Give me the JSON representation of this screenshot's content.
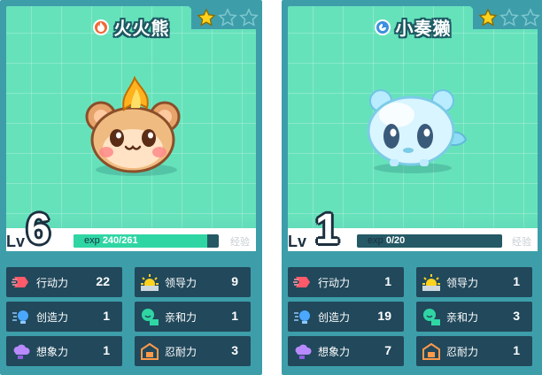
{
  "cards": [
    {
      "name": "火火熊",
      "element": "fire",
      "stars_filled": 1,
      "stars_total": 3,
      "level_label": "Lv",
      "level": "6",
      "exp_label": "exp",
      "exp_current": "240",
      "exp_max": "/261",
      "exp_fraction": 0.92,
      "upgrade_label": "经验",
      "stats": [
        {
          "label": "行动力",
          "value": "22",
          "icon": "speed-icon"
        },
        {
          "label": "领导力",
          "value": "9",
          "icon": "sun-icon"
        },
        {
          "label": "创造力",
          "value": "1",
          "icon": "bulb-icon"
        },
        {
          "label": "亲和力",
          "value": "1",
          "icon": "smile-icon"
        },
        {
          "label": "想象力",
          "value": "1",
          "icon": "cloud-icon"
        },
        {
          "label": "忍耐力",
          "value": "3",
          "icon": "box-icon"
        }
      ]
    },
    {
      "name": "小奏獭",
      "element": "water",
      "stars_filled": 1,
      "stars_total": 3,
      "level_label": "Lv",
      "level": "1",
      "exp_label": "exp",
      "exp_current": "0",
      "exp_max": "/20",
      "exp_fraction": 0,
      "upgrade_label": "经验",
      "stats": [
        {
          "label": "行动力",
          "value": "1",
          "icon": "speed-icon"
        },
        {
          "label": "领导力",
          "value": "1",
          "icon": "sun-icon"
        },
        {
          "label": "创造力",
          "value": "19",
          "icon": "bulb-icon"
        },
        {
          "label": "亲和力",
          "value": "3",
          "icon": "smile-icon"
        },
        {
          "label": "想象力",
          "value": "7",
          "icon": "cloud-icon"
        },
        {
          "label": "忍耐力",
          "value": "1",
          "icon": "box-icon"
        }
      ]
    }
  ],
  "colors": {
    "card_frame": "#3d9eaa",
    "scene_bg": "#66e2bb",
    "stat_bg": "#21485b",
    "exp_fill": "#2fd6a4",
    "star_gold": "#ffd21e"
  }
}
